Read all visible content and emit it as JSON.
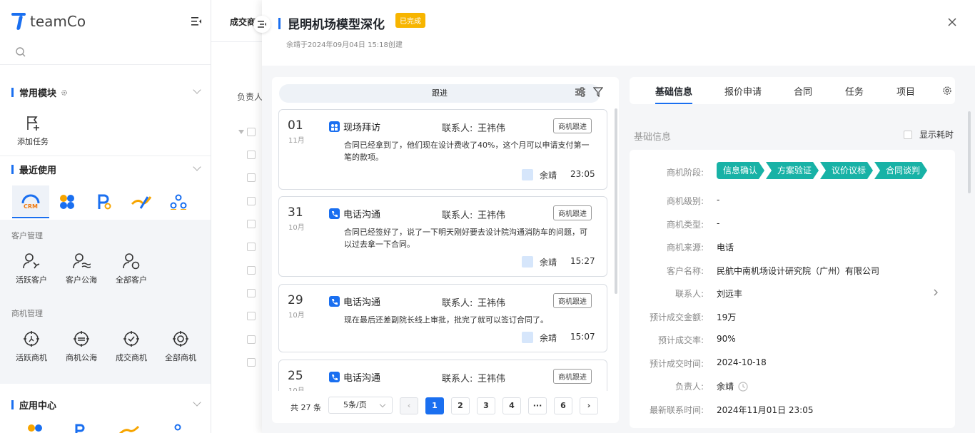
{
  "sidebar": {
    "logo_text": "teamCo",
    "section_common": "常用模块",
    "quick_add_task": "添加任务",
    "section_recent": "最近使用",
    "recent_apps": [
      "CRM",
      "apps",
      "P",
      "link",
      "org"
    ],
    "crm_label": "CRM",
    "group_customer": "客户管理",
    "customer_items": [
      "活跃客户",
      "客户公海",
      "全部客户"
    ],
    "group_opportunity": "商机管理",
    "opportunity_items": [
      "活跃商机",
      "商机公海",
      "成交商机",
      "全部商机"
    ],
    "section_apps": "应用中心"
  },
  "mid": {
    "header": "成交商",
    "owner_label": "负责人"
  },
  "panel": {
    "title": "昆明机场模型深化",
    "status_badge": "已完成",
    "subtitle": "余靖于2024年09月04日 15:18创建",
    "accent": "#1a6ff0",
    "badge_color": "#f7b500"
  },
  "followup": {
    "tab_label": "跟进",
    "cards": [
      {
        "day": "01",
        "month": "11月",
        "type": "现场拜访",
        "contact_label": "联系人:",
        "contact": "王祎伟",
        "tag": "商机跟进",
        "body": "合同已经拿到了，他们现在设计费收了40%，这个月可以申请支付第一笔的款项。",
        "user": "余靖",
        "time": "23:05"
      },
      {
        "day": "31",
        "month": "10月",
        "type": "电话沟通",
        "contact_label": "联系人:",
        "contact": "王祎伟",
        "tag": "商机跟进",
        "body": "合同已经签好了，说了一下明天刚好要去设计院沟通消防车的问题，可以过去拿一下合同。",
        "user": "余靖",
        "time": "15:27"
      },
      {
        "day": "29",
        "month": "10月",
        "type": "电话沟通",
        "contact_label": "联系人:",
        "contact": "王祎伟",
        "tag": "商机跟进",
        "body": "现在最后还差副院长线上审批，批完了就可以签订合同了。",
        "user": "余靖",
        "time": "15:07"
      },
      {
        "day": "25",
        "month": "10月",
        "type": "电话沟通",
        "contact_label": "联系人:",
        "contact": "王祎伟",
        "tag": "商机跟进",
        "body": "",
        "user": "",
        "time": ""
      }
    ],
    "pager": {
      "total": "共 27 条",
      "page_size": "5条/页",
      "pages": [
        "1",
        "2",
        "3",
        "4",
        "···",
        "6"
      ],
      "current": "1"
    }
  },
  "detail": {
    "tabs": [
      "基础信息",
      "报价申请",
      "合同",
      "任务",
      "项目"
    ],
    "active_tab": "基础信息",
    "section_title": "基础信息",
    "show_time_label": "显示耗时",
    "stage_label": "商机阶段:",
    "stages": [
      "信息确认",
      "方案验证",
      "议价议标",
      "合同谈判"
    ],
    "stage_color": "#18b2a6",
    "fields": [
      {
        "label": "商机级别:",
        "value": "-"
      },
      {
        "label": "商机类型:",
        "value": "-"
      },
      {
        "label": "商机来源:",
        "value": "电话"
      },
      {
        "label": "客户名称:",
        "value": "民航中南机场设计研究院（广州）有限公司"
      },
      {
        "label": "联系人:",
        "value": "刘远丰"
      },
      {
        "label": "预计成交金额:",
        "value": "19万"
      },
      {
        "label": "预计成交率:",
        "value": "90%"
      },
      {
        "label": "预计成交时间:",
        "value": "2024-10-18"
      },
      {
        "label": "负责人:",
        "value": "余靖"
      },
      {
        "label": "最新联系时间:",
        "value": "2024年11月01日 23:05"
      }
    ]
  }
}
